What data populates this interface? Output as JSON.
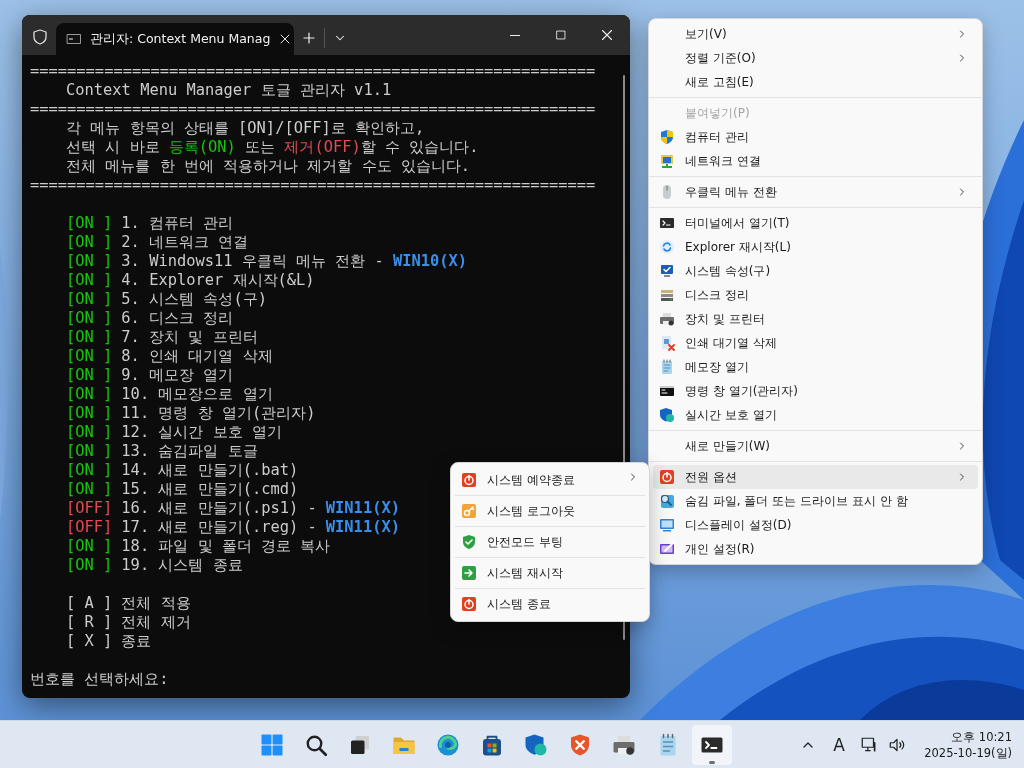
{
  "terminal": {
    "title": "관리자: Context Menu Manag",
    "lines": [
      {
        "kind": "rule",
        "text": "============================================================="
      },
      {
        "kind": "text",
        "segments": [
          {
            "text": "Context Menu Manager 토글 관리자 v1.1",
            "color": "#cccccc"
          }
        ]
      },
      {
        "kind": "rule",
        "text": "============================================================="
      },
      {
        "kind": "text",
        "segments": [
          {
            "text": "각 메뉴 항목의 상태를 [ON]/[OFF]로 확인하고,",
            "color": "#cccccc"
          }
        ]
      },
      {
        "kind": "text",
        "segments": [
          {
            "text": "선택 시 바로 ",
            "color": "#cccccc"
          },
          {
            "text": "등록(ON)",
            "color": "#16c60c"
          },
          {
            "text": " 또는 ",
            "color": "#cccccc"
          },
          {
            "text": "제거(OFF)",
            "color": "#e74856"
          },
          {
            "text": "할 수 있습니다.",
            "color": "#cccccc"
          }
        ]
      },
      {
        "kind": "text",
        "segments": [
          {
            "text": "전체 메뉴를 한 번에 적용하거나 제거할 수도 있습니다.",
            "color": "#cccccc"
          }
        ]
      },
      {
        "kind": "rule",
        "text": "============================================================="
      },
      {
        "kind": "blank"
      },
      {
        "kind": "item",
        "status": "[ON ]",
        "on": true,
        "label": "1. 컴퓨터 관리"
      },
      {
        "kind": "item",
        "status": "[ON ]",
        "on": true,
        "label": "2. 네트워크 연결"
      },
      {
        "kind": "item",
        "status": "[ON ]",
        "on": true,
        "label": "3. Windows11 우클릭 메뉴 전환 -",
        "note": "WIN10(X)"
      },
      {
        "kind": "item",
        "status": "[ON ]",
        "on": true,
        "label": "4. Explorer 재시작(&L)"
      },
      {
        "kind": "item",
        "status": "[ON ]",
        "on": true,
        "label": "5. 시스템 속성(구)"
      },
      {
        "kind": "item",
        "status": "[ON ]",
        "on": true,
        "label": "6. 디스크 정리"
      },
      {
        "kind": "item",
        "status": "[ON ]",
        "on": true,
        "label": "7. 장치 및 프린터"
      },
      {
        "kind": "item",
        "status": "[ON ]",
        "on": true,
        "label": "8. 인쇄 대기열 삭제"
      },
      {
        "kind": "item",
        "status": "[ON ]",
        "on": true,
        "label": "9. 메모장 열기"
      },
      {
        "kind": "item",
        "status": "[ON ]",
        "on": true,
        "label": "10. 메모장으로 열기"
      },
      {
        "kind": "item",
        "status": "[ON ]",
        "on": true,
        "label": "11. 명령 창 열기(관리자)"
      },
      {
        "kind": "item",
        "status": "[ON ]",
        "on": true,
        "label": "12. 실시간 보호 열기"
      },
      {
        "kind": "item",
        "status": "[ON ]",
        "on": true,
        "label": "13. 숨김파일 토글"
      },
      {
        "kind": "item",
        "status": "[ON ]",
        "on": true,
        "label": "14. 새로 만들기(.bat)"
      },
      {
        "kind": "item",
        "status": "[ON ]",
        "on": true,
        "label": "15. 새로 만들기(.cmd)"
      },
      {
        "kind": "item",
        "status": "[OFF]",
        "on": false,
        "label": "16. 새로 만들기(.ps1) -",
        "note": "WIN11(X)"
      },
      {
        "kind": "item",
        "status": "[OFF]",
        "on": false,
        "label": "17. 새로 만들기(.reg) -",
        "note": "WIN11(X)"
      },
      {
        "kind": "item",
        "status": "[ON ]",
        "on": true,
        "label": "18. 파일 및 폴더 경로 복사"
      },
      {
        "kind": "item",
        "status": "[ON ]",
        "on": true,
        "label": "19. 시스템 종료"
      },
      {
        "kind": "blank"
      },
      {
        "kind": "option",
        "key": "[ A ]",
        "label": "전체 적용"
      },
      {
        "kind": "option",
        "key": "[ R ]",
        "label": "전체 제거"
      },
      {
        "kind": "option",
        "key": "[ X ]",
        "label": "종료"
      },
      {
        "kind": "blank"
      },
      {
        "kind": "prompt",
        "text": "번호를 선택하세요:"
      }
    ]
  },
  "context_menu": {
    "groups": [
      [
        {
          "label": "보기(V)",
          "submenu": true,
          "disabled": false,
          "selected": false
        },
        {
          "label": "정렬 기준(O)",
          "submenu": true,
          "disabled": false,
          "selected": false
        },
        {
          "label": "새로 고침(E)",
          "submenu": false,
          "disabled": false,
          "selected": false
        }
      ],
      [
        {
          "label": "붙여넣기(P)",
          "submenu": false,
          "disabled": true,
          "selected": false
        },
        {
          "label": "컴퓨터 관리",
          "submenu": false,
          "disabled": false,
          "selected": false
        },
        {
          "label": "네트워크 연결",
          "submenu": false,
          "disabled": false,
          "selected": false
        }
      ],
      [
        {
          "label": "우클릭 메뉴 전환",
          "submenu": true,
          "disabled": false,
          "selected": false
        }
      ],
      [
        {
          "label": "터미널에서 열기(T)",
          "submenu": false,
          "disabled": false,
          "selected": false
        },
        {
          "label": "Explorer 재시작(L)",
          "submenu": false,
          "disabled": false,
          "selected": false
        },
        {
          "label": "시스템 속성(구)",
          "submenu": false,
          "disabled": false,
          "selected": false
        },
        {
          "label": "디스크 정리",
          "submenu": false,
          "disabled": false,
          "selected": false
        },
        {
          "label": "장치 및 프린터",
          "submenu": false,
          "disabled": false,
          "selected": false
        },
        {
          "label": "인쇄 대기열 삭제",
          "submenu": false,
          "disabled": false,
          "selected": false
        },
        {
          "label": "메모장 열기",
          "submenu": false,
          "disabled": false,
          "selected": false
        },
        {
          "label": "명령 창 열기(관리자)",
          "submenu": false,
          "disabled": false,
          "selected": false
        },
        {
          "label": "실시간 보호 열기",
          "submenu": false,
          "disabled": false,
          "selected": false
        }
      ],
      [
        {
          "label": "새로 만들기(W)",
          "submenu": true,
          "disabled": false,
          "selected": false
        }
      ],
      [
        {
          "label": "전원 옵션",
          "submenu": true,
          "disabled": false,
          "selected": true
        },
        {
          "label": "숨김 파일, 폴더 또는 드라이브 표시 안 함",
          "submenu": false,
          "disabled": false,
          "selected": false
        },
        {
          "label": "디스플레이 설정(D)",
          "submenu": false,
          "disabled": false,
          "selected": false
        },
        {
          "label": "개인 설정(R)",
          "submenu": false,
          "disabled": false,
          "selected": false
        }
      ]
    ]
  },
  "power_submenu": {
    "items": [
      {
        "label": "시스템 예약종료",
        "submenu": true
      },
      {
        "label": "시스템 로그아웃",
        "submenu": false
      },
      {
        "label": "안전모드 부팅",
        "submenu": false
      },
      {
        "label": "시스템 재시작",
        "submenu": false
      },
      {
        "label": "시스템 종료",
        "submenu": false
      }
    ]
  },
  "taskbar": {
    "apps": [
      {
        "active": false
      },
      {
        "active": false
      },
      {
        "active": false
      },
      {
        "active": false
      },
      {
        "active": false
      },
      {
        "active": false
      },
      {
        "active": false
      },
      {
        "active": false
      },
      {
        "active": false
      },
      {
        "active": false
      },
      {
        "active": true
      }
    ],
    "ime": "A",
    "time": "오후 10:21",
    "date": "2025-10-19(일)"
  }
}
